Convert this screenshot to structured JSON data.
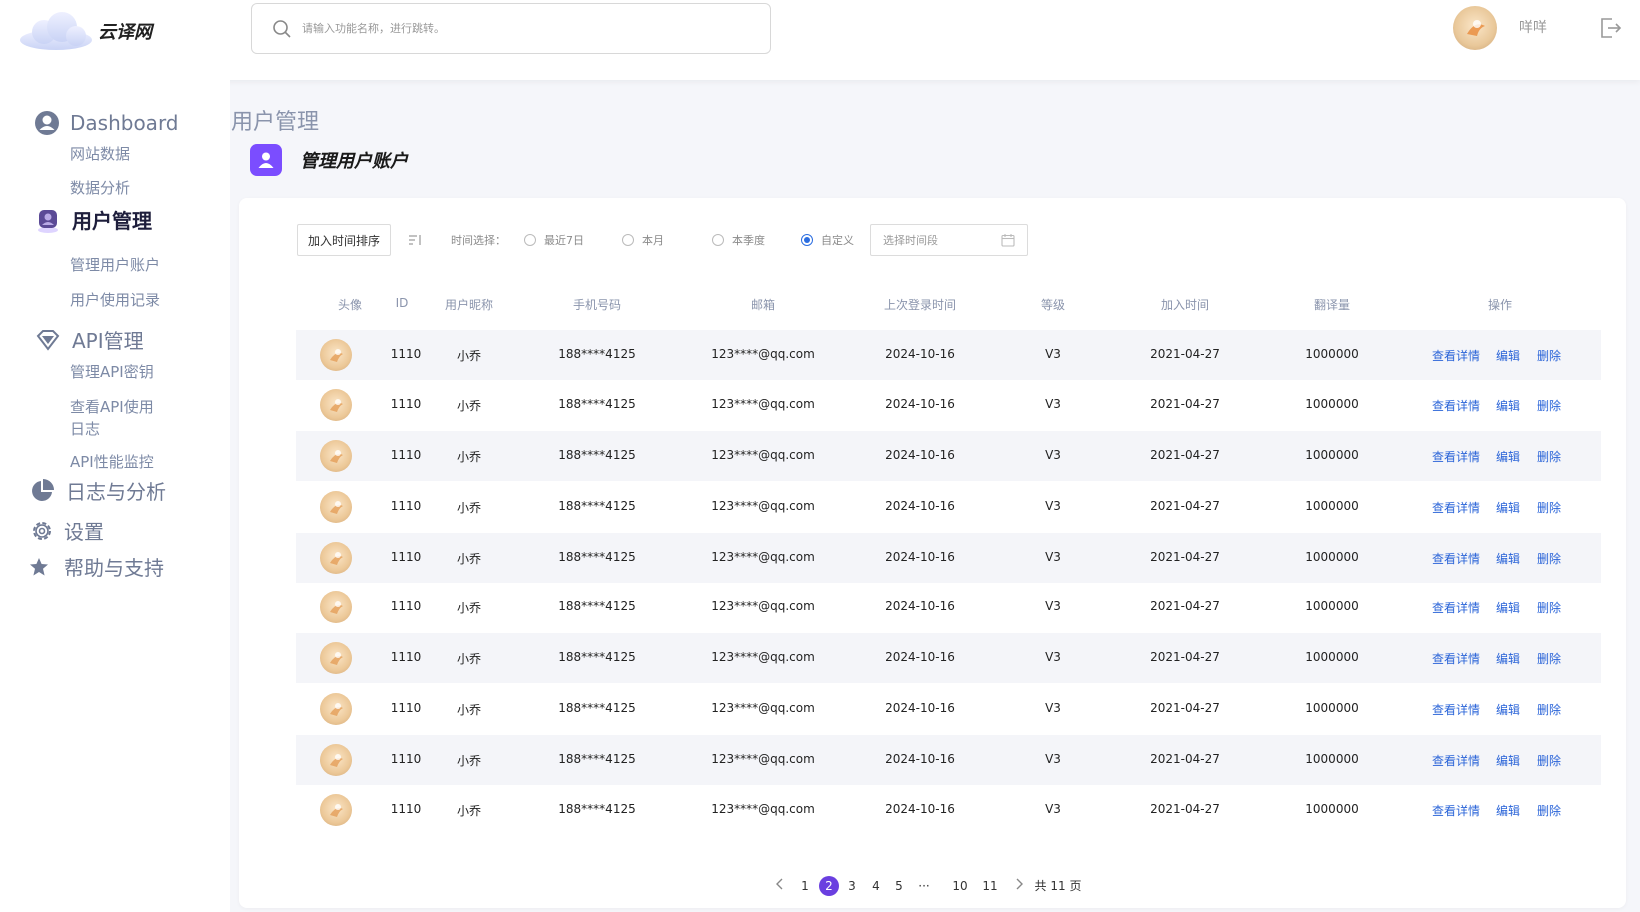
{
  "header": {
    "brand": "云译网",
    "search_placeholder": "请输入功能名称，进行跳转。",
    "user_name": "咩咩"
  },
  "sidebar": {
    "groups": [
      {
        "label": "Dashboard",
        "icon": "user-circle-icon",
        "items": [
          "网站数据",
          "数据分析"
        ]
      },
      {
        "label": "用户管理",
        "icon": "user-badge-icon",
        "active": true,
        "items": [
          "管理用户账户",
          "用户使用记录"
        ]
      },
      {
        "label": "API管理",
        "icon": "diamond-icon",
        "items": [
          "管理API密钥",
          "查看API使用日志",
          "API性能监控"
        ]
      },
      {
        "label": "日志与分析",
        "icon": "pie-chart-icon",
        "items": []
      },
      {
        "label": "设置",
        "icon": "gear-icon",
        "items": []
      },
      {
        "label": "帮助与支持",
        "icon": "star-icon",
        "items": []
      }
    ],
    "api_log_line1": "查看API使用",
    "api_log_line2": "日志"
  },
  "page": {
    "title": "用户管理",
    "subtitle": "管理用户账户"
  },
  "filters": {
    "sort_label": "加入时间排序",
    "time_label": "时间选择：",
    "options": [
      "最近7日",
      "本月",
      "本季度",
      "自定义"
    ],
    "selected": "自定义",
    "date_placeholder": "选择时间段"
  },
  "table": {
    "columns": [
      "头像",
      "ID",
      "用户昵称",
      "手机号码",
      "邮箱",
      "上次登录时间",
      "等级",
      "加入时间",
      "翻译量",
      "操作"
    ],
    "actions": [
      "查看详情",
      "编辑",
      "删除"
    ],
    "rows": [
      {
        "id": "1110",
        "nickname": "小乔",
        "phone": "188****4125",
        "email": "123****@qq.com",
        "last_login": "2024-10-16",
        "level": "V3",
        "joined": "2021-04-27",
        "volume": "1000000"
      },
      {
        "id": "1110",
        "nickname": "小乔",
        "phone": "188****4125",
        "email": "123****@qq.com",
        "last_login": "2024-10-16",
        "level": "V3",
        "joined": "2021-04-27",
        "volume": "1000000"
      },
      {
        "id": "1110",
        "nickname": "小乔",
        "phone": "188****4125",
        "email": "123****@qq.com",
        "last_login": "2024-10-16",
        "level": "V3",
        "joined": "2021-04-27",
        "volume": "1000000"
      },
      {
        "id": "1110",
        "nickname": "小乔",
        "phone": "188****4125",
        "email": "123****@qq.com",
        "last_login": "2024-10-16",
        "level": "V3",
        "joined": "2021-04-27",
        "volume": "1000000"
      },
      {
        "id": "1110",
        "nickname": "小乔",
        "phone": "188****4125",
        "email": "123****@qq.com",
        "last_login": "2024-10-16",
        "level": "V3",
        "joined": "2021-04-27",
        "volume": "1000000"
      },
      {
        "id": "1110",
        "nickname": "小乔",
        "phone": "188****4125",
        "email": "123****@qq.com",
        "last_login": "2024-10-16",
        "level": "V3",
        "joined": "2021-04-27",
        "volume": "1000000"
      },
      {
        "id": "1110",
        "nickname": "小乔",
        "phone": "188****4125",
        "email": "123****@qq.com",
        "last_login": "2024-10-16",
        "level": "V3",
        "joined": "2021-04-27",
        "volume": "1000000"
      },
      {
        "id": "1110",
        "nickname": "小乔",
        "phone": "188****4125",
        "email": "123****@qq.com",
        "last_login": "2024-10-16",
        "level": "V3",
        "joined": "2021-04-27",
        "volume": "1000000"
      },
      {
        "id": "1110",
        "nickname": "小乔",
        "phone": "188****4125",
        "email": "123****@qq.com",
        "last_login": "2024-10-16",
        "level": "V3",
        "joined": "2021-04-27",
        "volume": "1000000"
      },
      {
        "id": "1110",
        "nickname": "小乔",
        "phone": "188****4125",
        "email": "123****@qq.com",
        "last_login": "2024-10-16",
        "level": "V3",
        "joined": "2021-04-27",
        "volume": "1000000"
      }
    ]
  },
  "pagination": {
    "pages": [
      "1",
      "2",
      "3",
      "4",
      "5",
      "···",
      "10",
      "11"
    ],
    "current": "2",
    "total_label": "共 11 页"
  },
  "colors": {
    "accent": "#6a3fe0",
    "link": "#2a64d8",
    "radio_on": "#2b6de0"
  }
}
